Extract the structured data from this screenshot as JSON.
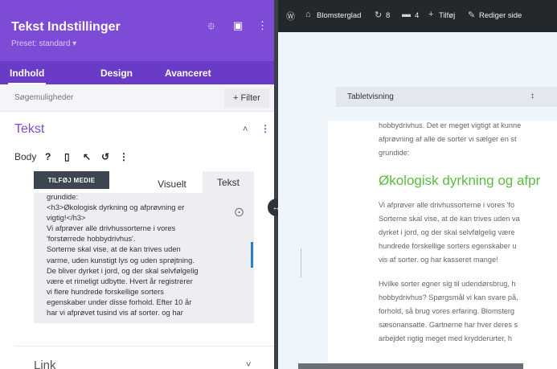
{
  "panel": {
    "title": "Tekst Indstillinger",
    "preset": "Preset: standard ▾",
    "tabs": [
      "Indhold",
      "Design",
      "Avanceret"
    ],
    "search_placeholder": "Søgemuligheder",
    "filter_label": "+ Filter"
  },
  "section": {
    "title": "Tekst",
    "body_label": "Body",
    "add_media_label": "TILFØJ MEDIE",
    "tab_visual": "Visuelt",
    "tab_text": "Tekst",
    "code": "grundide:\n<h3>Økologisk dyrkning og afprøvning er\nvigtig!</h3>\nVi afprøver alle drivhussorterne i vores\n'forstørrede hobbydrivhus'.\nSorterne skal vise, at de kan trives uden\nvarme, uden kunstigt lys og uden sprøjtning.\nDe bliver dyrket i jord, og der skal selvfølgelig\nvære et rimeligt udbytte. Hvert år registrerer\nvi flere hundrede forskellige sorters\negenskaber under disse forhold. Efter 10 år\nhar vi afprøvet tusind vis af sorter. og har"
  },
  "link_section": {
    "title": "Link"
  },
  "adminbar": {
    "site_name": "Blomsterglad",
    "updates_count": "8",
    "comments_count": "4",
    "add_label": "Tilføj",
    "edit_label": "Rediger side"
  },
  "builder": {
    "view_select": "Tabletvisning",
    "lines_top": [
      "hobbydrivhus. Det er meget vigtigt at kunne",
      "afprøvning af alle de sorter vi sælger en st",
      "grundide:"
    ],
    "heading": "Økologisk dyrkning og afpr",
    "para1": [
      "Vi afprøver alle drivhussorterne i vores 'fo",
      "Sorterne skal vise, at de kan trives uden va",
      "dyrket i jord, og der skal selvfølgelig være",
      "hundrede forskellige sorters egenskaber u",
      "vis af sorter. og har kasseret mange!"
    ],
    "para2": [
      "Hvilke sorter egner sig til udendørsbrug, h",
      "hobbydrivhus? Spørgsmål vi kan svare på,",
      "forhold, så brug vores erfaring. Blomsterg",
      "sæsonansatte. Gartnerne har hver deres s",
      "arbejdet rigtig meget med krydderurter, h"
    ]
  },
  "colors": {
    "panel_header": "#7e4bd6",
    "tabs_bar": "#6a3bc7",
    "heading_green": "#5cbc3f",
    "adminbar": "#23282d"
  }
}
